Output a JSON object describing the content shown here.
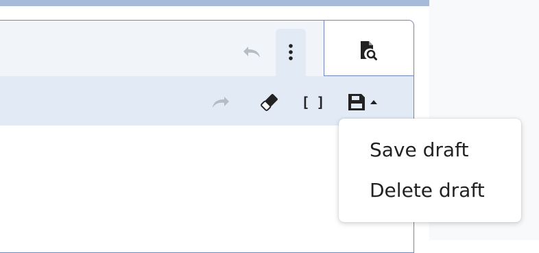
{
  "colors": {
    "top_band": "#a7bbd9",
    "toolbar_light": "#f1f5fa",
    "toolbar_dark": "#e2ebf5",
    "border": "#6f87ba",
    "icon": "#222222",
    "icon_disabled": "#b5bcc4",
    "right_panel": "#f8f9fa"
  },
  "toolbar": {
    "icons": {
      "undo": "undo-icon",
      "more": "more-vertical-icon",
      "preview": "file-search-icon",
      "redo": "redo-icon",
      "eraser": "eraser-icon",
      "brackets": "brackets-icon",
      "save": "save-icon",
      "caret": "caret-up-icon"
    },
    "brackets_glyph": "[ ]"
  },
  "menu": {
    "items": [
      {
        "label": "Save draft"
      },
      {
        "label": "Delete draft"
      }
    ]
  }
}
